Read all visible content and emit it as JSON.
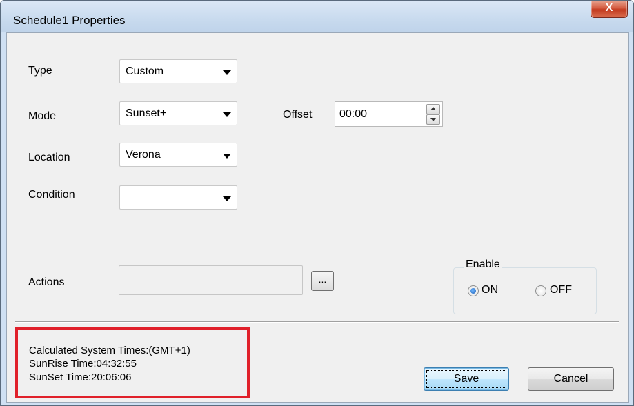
{
  "window": {
    "title": "Schedule1 Properties",
    "close_label": "X"
  },
  "fields": {
    "type": {
      "label": "Type",
      "value": "Custom"
    },
    "mode": {
      "label": "Mode",
      "value": "Sunset+"
    },
    "offset": {
      "label": "Offset",
      "value": "00:00"
    },
    "location": {
      "label": "Location",
      "value": "Verona"
    },
    "condition": {
      "label": "Condition",
      "value": ""
    },
    "actions": {
      "label": "Actions",
      "value": "",
      "browse_label": "..."
    }
  },
  "enable": {
    "title": "Enable",
    "on_label": "ON",
    "off_label": "OFF",
    "selected": "ON"
  },
  "info": {
    "calc_line": "Calculated System Times:(GMT+1)",
    "sunrise_line": "SunRise Time:04:32:55",
    "sunset_line": "SunSet Time:20:06:06"
  },
  "buttons": {
    "save": "Save",
    "cancel": "Cancel"
  },
  "colors": {
    "highlight": "#e0202a",
    "close_button": "#c23a1f"
  }
}
